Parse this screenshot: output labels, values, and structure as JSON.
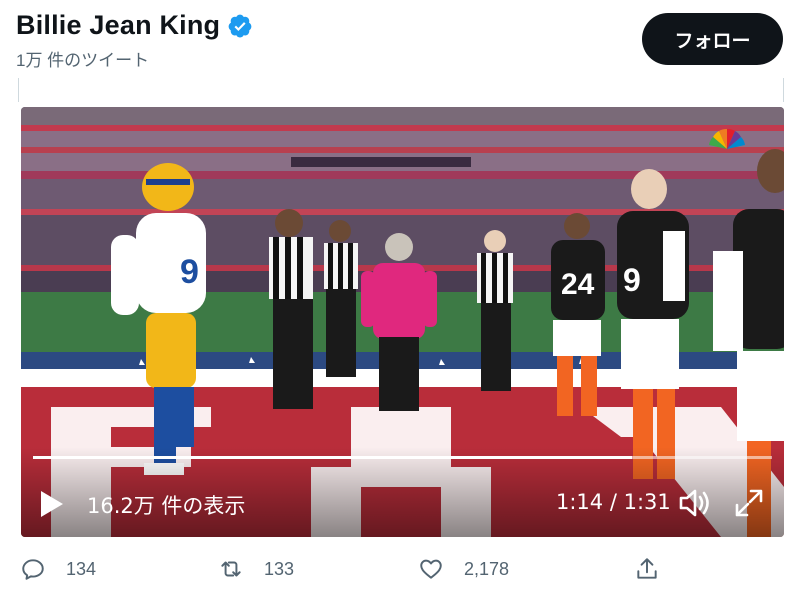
{
  "header": {
    "display_name": "Billie Jean King",
    "tweet_count": "1万 件のツイート",
    "follow_label": "フォロー",
    "verified_icon": "verified-badge-icon",
    "verified_color": "#1d9bf0"
  },
  "video": {
    "views_label": "16.2万 件の表示",
    "current_time": "1:14",
    "duration": "1:31",
    "time_label": "1:14 / 1:31",
    "progress": 0.81,
    "icons": {
      "play": "play-icon",
      "volume": "volume-icon",
      "fullscreen": "fullscreen-icon"
    }
  },
  "actions": {
    "reply_count": "134",
    "retweet_count": "133",
    "like_count": "2,178",
    "icons": [
      "reply-icon",
      "retweet-icon",
      "like-icon",
      "share-icon"
    ]
  },
  "colors": {
    "text_primary": "#0f1419",
    "text_secondary": "#536471",
    "follow_bg": "#0f1419"
  }
}
